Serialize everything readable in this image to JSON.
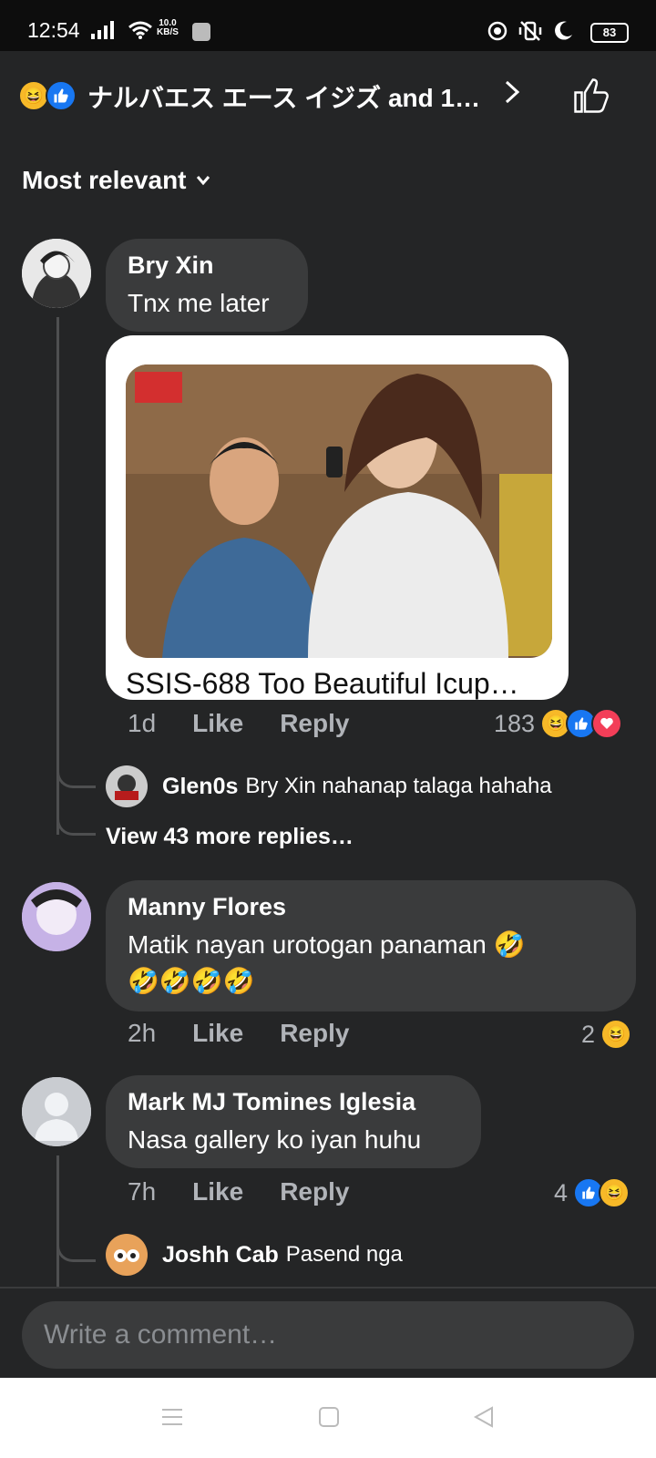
{
  "status": {
    "time": "12:54",
    "net_speed": "10.0",
    "net_unit": "KB/S",
    "battery": "83"
  },
  "header": {
    "title": "ナルバエス エース イジズ and 1…",
    "reactions": [
      "laugh-emoji",
      "like-emoji"
    ]
  },
  "sort": {
    "label": "Most relevant"
  },
  "comments": [
    {
      "name": "Bry Xin",
      "text": "Tnx me later",
      "time": "1d",
      "like": "Like",
      "reply": "Reply",
      "reaction_count": "183",
      "link_title": "SSIS-688 Too Beautiful Icup…",
      "replies": [
        {
          "name": "Glen0s",
          "text": "Bry Xin nahanap talaga hahaha"
        }
      ],
      "more_replies": "View 43 more replies…"
    },
    {
      "name": "Manny Flores",
      "text": "Matik nayan urotogan panaman 🤣",
      "text2": "🤣🤣🤣🤣",
      "time": "2h",
      "like": "Like",
      "reply": "Reply",
      "reaction_count": "2"
    },
    {
      "name": "Mark MJ Tomines Iglesia",
      "text": "Nasa gallery ko iyan huhu",
      "time": "7h",
      "like": "Like",
      "reply": "Reply",
      "reaction_count": "4",
      "replies": [
        {
          "name": "Joshh Cab",
          "text": "Pasend nga"
        }
      ]
    }
  ],
  "composer": {
    "placeholder": "Write a comment…"
  },
  "colors": {
    "background": "#242526",
    "bubble": "#3a3b3c",
    "like_blue": "#1877f2",
    "love_red": "#f33e58",
    "laugh_yellow": "#f7b928"
  }
}
